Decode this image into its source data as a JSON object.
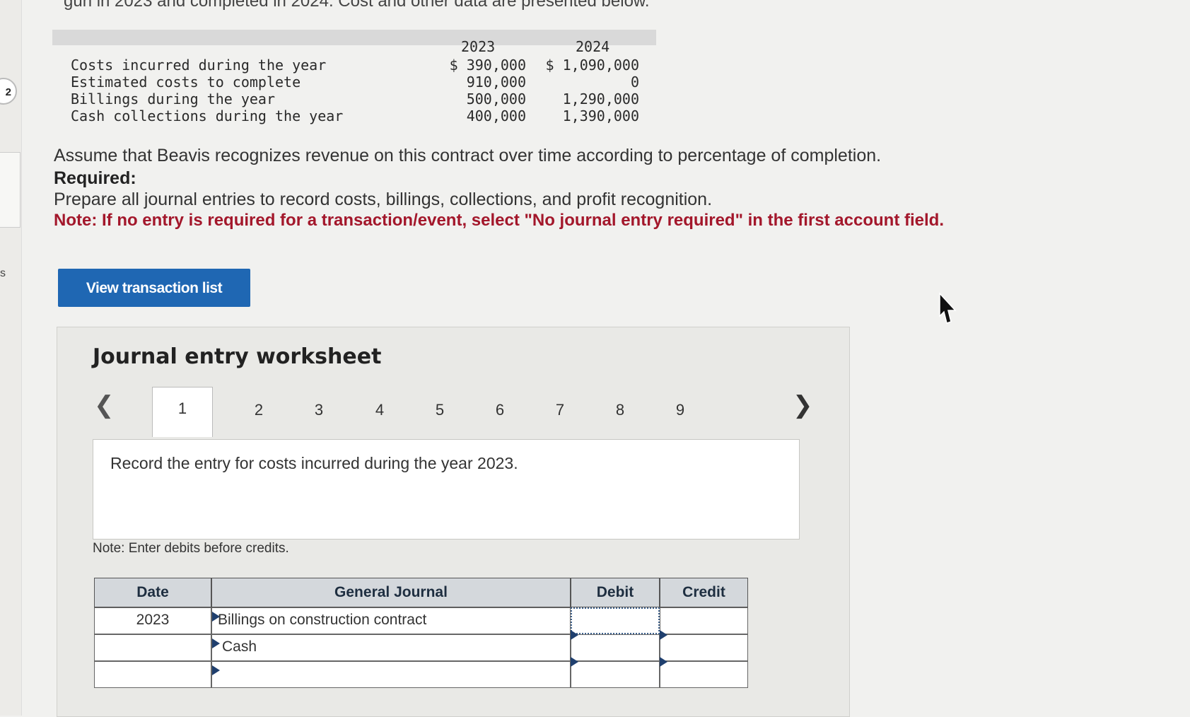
{
  "top_text": "gun in 2023 and completed in 2024. Cost and other data are presented below.",
  "side": {
    "step_number": "2",
    "letter": "s"
  },
  "data_table": {
    "years": [
      "2023",
      "2024"
    ],
    "rows": [
      {
        "label": "Costs incurred during the year",
        "v2023": "$ 390,000",
        "v2024": "$ 1,090,000"
      },
      {
        "label": "Estimated costs to complete",
        "v2023": "910,000",
        "v2024": "0"
      },
      {
        "label": "Billings during the year",
        "v2023": "500,000",
        "v2024": "1,290,000"
      },
      {
        "label": "Cash collections during the year",
        "v2023": "400,000",
        "v2024": "1,390,000"
      }
    ]
  },
  "instructions": {
    "assume": "Assume that Beavis recognizes revenue on this contract over time according to percentage of completion.",
    "required": "Required:",
    "prepare": "Prepare all journal entries to record costs, billings, collections, and profit recognition.",
    "note": "Note: If no entry is required for a transaction/event, select \"No journal entry required\" in the first account field."
  },
  "view_button": "View transaction list",
  "worksheet": {
    "title": "Journal entry worksheet",
    "prev_icon": "chevron-left",
    "next_icon": "chevron-right",
    "tabs": [
      "1",
      "2",
      "3",
      "4",
      "5",
      "6",
      "7",
      "8",
      "9"
    ],
    "active_tab": "1",
    "instruction": "Record the entry for costs incurred during the year 2023.",
    "note": "Note: Enter debits before credits.",
    "table": {
      "headers": {
        "date": "Date",
        "journal": "General Journal",
        "debit": "Debit",
        "credit": "Credit"
      },
      "rows": [
        {
          "date": "2023",
          "account": "Billings on construction contract",
          "debit": "",
          "credit": ""
        },
        {
          "date": "",
          "account": "Cash",
          "debit": "",
          "credit": ""
        },
        {
          "date": "",
          "account": "",
          "debit": "",
          "credit": ""
        }
      ]
    }
  }
}
